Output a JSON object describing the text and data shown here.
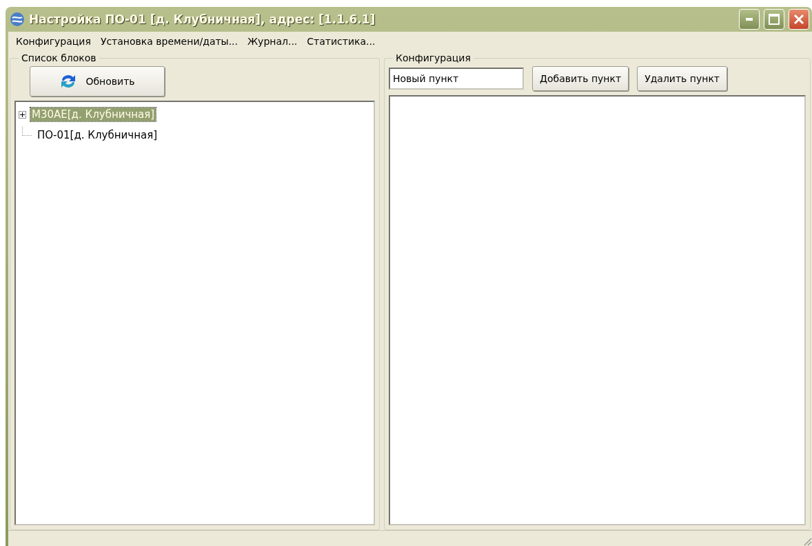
{
  "window": {
    "title": "Настройка ПО-01 [д. Клубничная], адрес: [1.1.6.1]"
  },
  "menu": [
    "Конфигурация",
    "Установка времени/даты...",
    "Журнал...",
    "Статистика..."
  ],
  "blocks_panel": {
    "title": "Список блоков",
    "refresh_button": "Обновить",
    "tree": [
      {
        "kind": "branch",
        "label": "М30АЕ[д. Клубничная]",
        "selected": true,
        "expanded": false
      },
      {
        "kind": "leaf",
        "label": "ПО-01[д. Клубничная]",
        "selected": false
      }
    ]
  },
  "config_panel": {
    "title": "Конфигурация",
    "item_field": {
      "value": "Новый пункт"
    },
    "buttons": [
      "Добавить пункт",
      "Удалить пункт"
    ]
  }
}
